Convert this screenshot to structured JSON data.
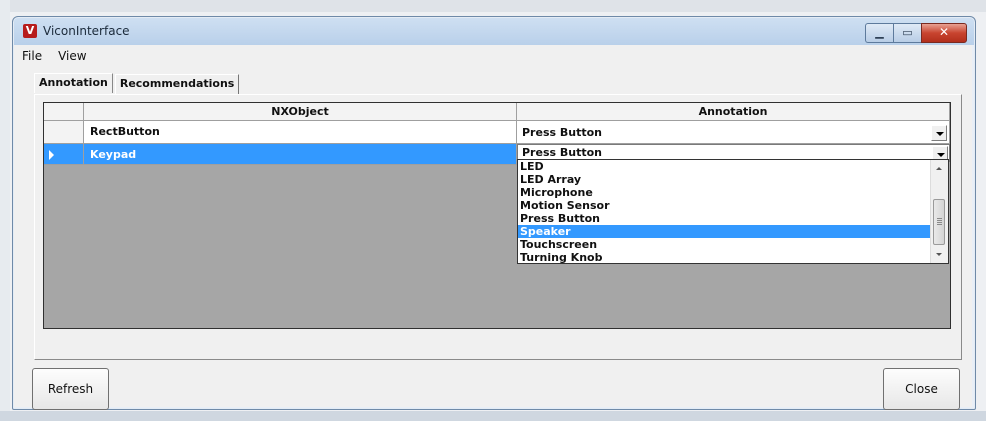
{
  "window": {
    "title": "ViconInterface",
    "icon_letter": "V"
  },
  "menu": {
    "items": [
      "File",
      "View"
    ]
  },
  "tabs": [
    "Annotation",
    "Recommendations"
  ],
  "grid": {
    "headers": {
      "object": "NXObject",
      "annotation": "Annotation"
    },
    "rows": [
      {
        "object": "RectButton",
        "annotation": "Press Button",
        "selected": false
      },
      {
        "object": "Keypad",
        "annotation": "Press Button",
        "selected": true
      }
    ]
  },
  "dropdown": {
    "options": [
      "LED",
      "LED Array",
      "Microphone",
      "Motion Sensor",
      "Press Button",
      "Speaker",
      "Touchscreen",
      "Turning Knob"
    ],
    "highlighted": "Speaker"
  },
  "buttons": {
    "refresh": "Refresh",
    "close": "Close"
  },
  "colors": {
    "selection": "#3399ff",
    "grid_background": "#a6a6a6"
  }
}
